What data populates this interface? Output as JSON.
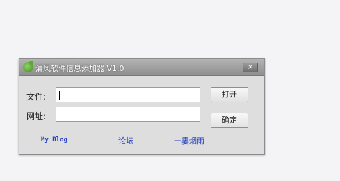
{
  "window": {
    "title": "清风软件信息添加器 V1.0",
    "close_glyph": "×"
  },
  "form": {
    "file_label": "文件:",
    "file_value": "",
    "url_label": "网址:",
    "url_value": "",
    "open_button": "打开",
    "ok_button": "确定"
  },
  "links": {
    "blog": "My Blog",
    "forum": "论坛",
    "third": "一霎烟雨"
  },
  "colors": {
    "link": "#2642c4",
    "window_bg": "#dedede"
  }
}
